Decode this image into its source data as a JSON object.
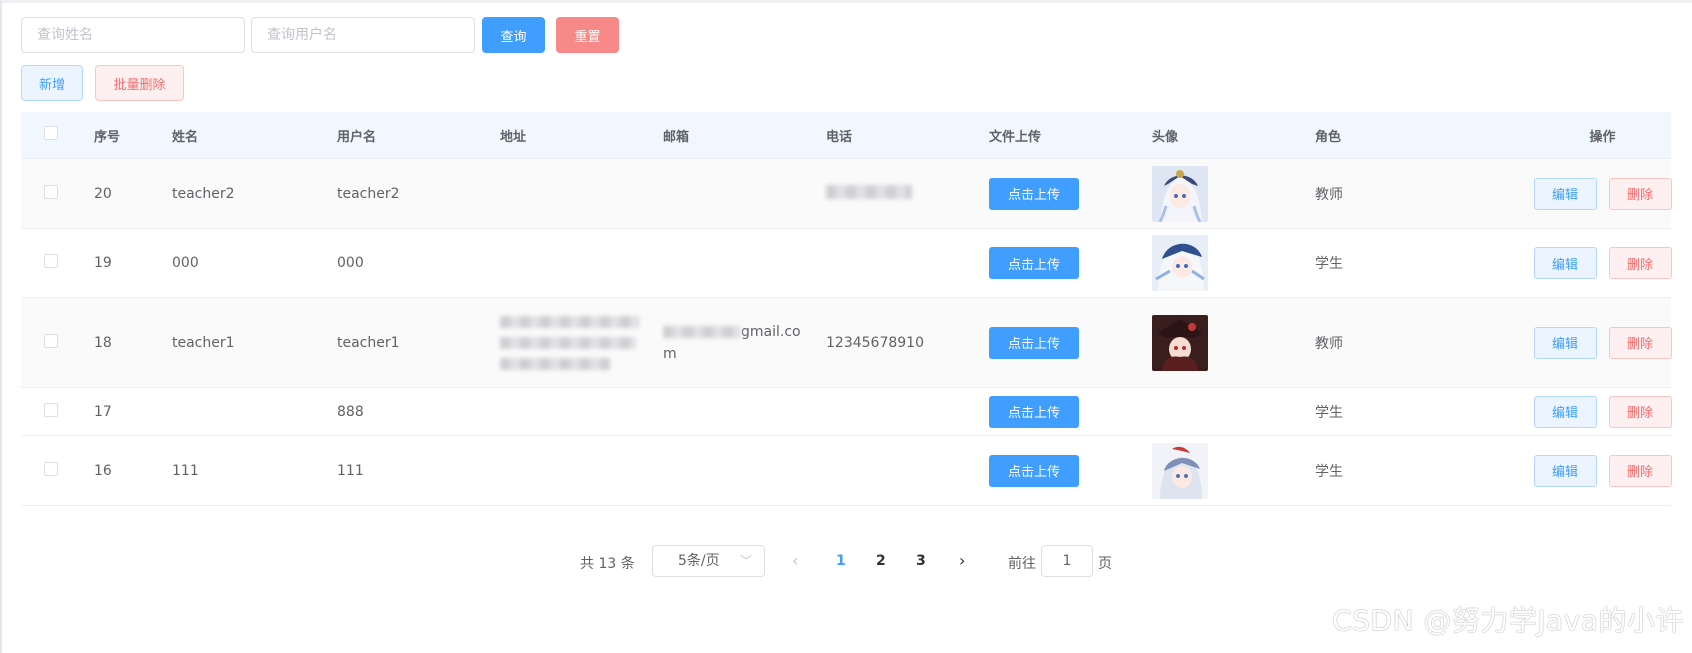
{
  "search": {
    "name_placeholder": "查询姓名",
    "username_placeholder": "查询用户名",
    "query_label": "查询",
    "reset_label": "重置"
  },
  "actions": {
    "add_label": "新增",
    "batch_delete_label": "批量删除"
  },
  "table": {
    "headers": {
      "id": "序号",
      "name": "姓名",
      "username": "用户名",
      "address": "地址",
      "email": "邮箱",
      "phone": "电话",
      "upload": "文件上传",
      "avatar": "头像",
      "role": "角色",
      "ops": "操作"
    },
    "upload_label": "点击上传",
    "edit_label": "编辑",
    "delete_label": "删除",
    "rows": [
      {
        "id": "20",
        "name": "teacher2",
        "username": "teacher2",
        "address": "",
        "email": "",
        "phone": "",
        "role": "教师"
      },
      {
        "id": "19",
        "name": "000",
        "username": "000",
        "address": "",
        "email": "",
        "phone": "",
        "role": "学生"
      },
      {
        "id": "18",
        "name": "teacher1",
        "username": "teacher1",
        "address": "",
        "email_line1": "gmail.co",
        "email_line2": "m",
        "phone": "12345678910",
        "role": "教师"
      },
      {
        "id": "17",
        "name": "",
        "username": "888",
        "address": "",
        "email": "",
        "phone": "",
        "role": "学生"
      },
      {
        "id": "16",
        "name": "111",
        "username": "111",
        "address": "",
        "email": "",
        "phone": "",
        "role": "学生"
      }
    ]
  },
  "pagination": {
    "total": "共 13 条",
    "page_size": "5条/页",
    "pages": [
      "1",
      "2",
      "3"
    ],
    "current": "1",
    "goto_label": "前往",
    "jump_value": "1",
    "page_unit": "页"
  },
  "watermark": "CSDN @努力学Java的小许",
  "colors": {
    "primary": "#409eff",
    "danger": "#f56c6c",
    "header_bg": "#f0f7ff"
  }
}
